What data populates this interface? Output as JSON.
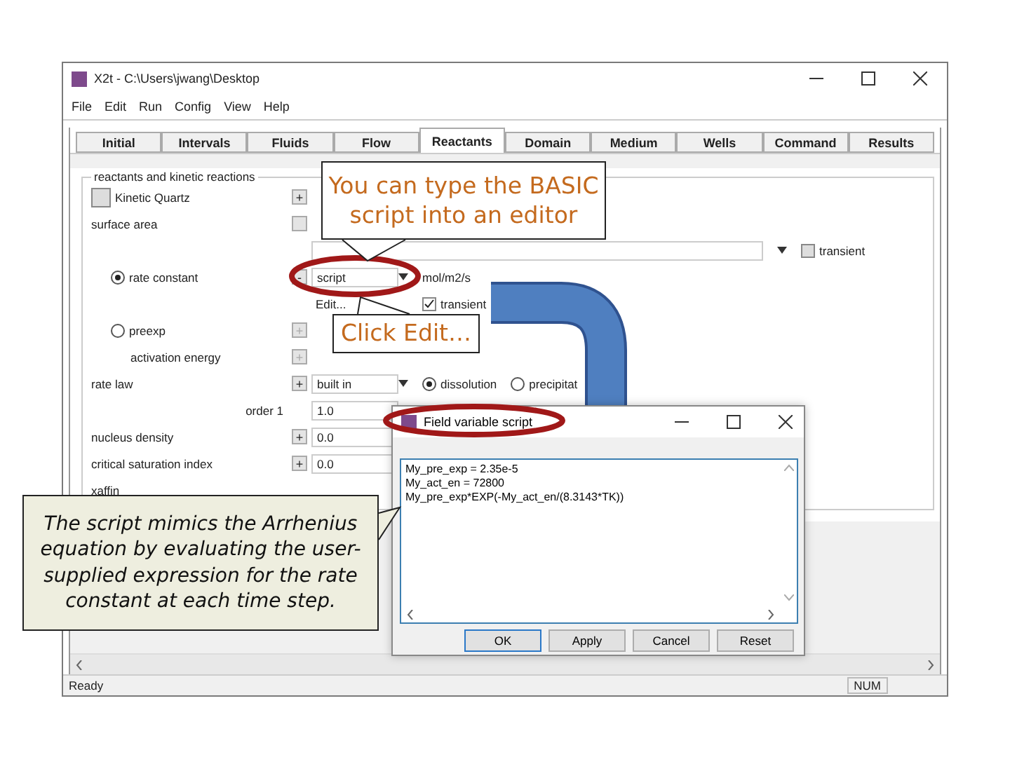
{
  "window": {
    "title": "X2t - C:\\Users\\jwang\\Desktop"
  },
  "menu": [
    "File",
    "Edit",
    "Run",
    "Config",
    "View",
    "Help"
  ],
  "tabs": [
    {
      "label": "Initial",
      "selected": false
    },
    {
      "label": "Intervals",
      "selected": false
    },
    {
      "label": "Fluids",
      "selected": false
    },
    {
      "label": "Flow",
      "selected": false
    },
    {
      "label": "Reactants",
      "selected": true
    },
    {
      "label": "Domain",
      "selected": false
    },
    {
      "label": "Medium",
      "selected": false
    },
    {
      "label": "Wells",
      "selected": false
    },
    {
      "label": "Command",
      "selected": false
    },
    {
      "label": "Results",
      "selected": false
    }
  ],
  "group": {
    "title": "reactants and kinetic reactions",
    "rows": [
      {
        "kind": "checkbox",
        "label": "Kinetic Quartz",
        "checked": false,
        "button": "+"
      },
      {
        "kind": "plain",
        "label": "surface area",
        "button_disabled": true
      },
      {
        "kind": "wide",
        "transient": {
          "label": "transient",
          "checked": false
        }
      },
      {
        "kind": "radio",
        "label": "rate constant",
        "selected": true,
        "button": "-",
        "value": "script",
        "unit": "mol/m2/s"
      },
      {
        "kind": "edit",
        "link": "Edit...",
        "transient": {
          "label": "transient",
          "checked": true
        }
      },
      {
        "kind": "radio",
        "label": "preexp",
        "selected": false,
        "button": "+",
        "button_disabled": true
      },
      {
        "kind": "sub",
        "label": "activation energy",
        "button": "+",
        "button_disabled": true
      },
      {
        "kind": "plain",
        "label": "rate law",
        "button": "+",
        "value": "built in",
        "dropdown": true,
        "options": [
          {
            "label": "dissolution",
            "selected": true
          },
          {
            "label": "precipitat",
            "selected": false
          }
        ]
      },
      {
        "kind": "order",
        "label": "order 1",
        "value": "1.0"
      },
      {
        "kind": "plain",
        "label": "nucleus density",
        "button": "+",
        "value": "0.0"
      },
      {
        "kind": "plain",
        "label": "critical saturation index",
        "button": "+",
        "value": "0.0"
      },
      {
        "kind": "plain",
        "label": "xaffin"
      }
    ]
  },
  "status_bar": {
    "message": "Ready",
    "indicator": "NUM"
  },
  "dialog": {
    "title": "Field variable script",
    "lines": [
      "My_pre_exp = 2.35e-5",
      "My_act_en = 72800",
      "My_pre_exp*EXP(-My_act_en/(8.3143*TK))"
    ],
    "buttons": [
      {
        "label": "OK",
        "focused": true
      },
      {
        "label": "Apply",
        "focused": false
      },
      {
        "label": "Cancel",
        "focused": false
      },
      {
        "label": "Reset",
        "focused": false
      }
    ]
  },
  "callouts": [
    {
      "kind": "note",
      "text": "You can type the BASIC script into an editor"
    },
    {
      "kind": "note",
      "text": "Click Edit…"
    },
    {
      "kind": "comment",
      "text": "The script mimics the Arrhenius equation by evaluating the user-supplied expression for the rate constant at each time step."
    }
  ]
}
